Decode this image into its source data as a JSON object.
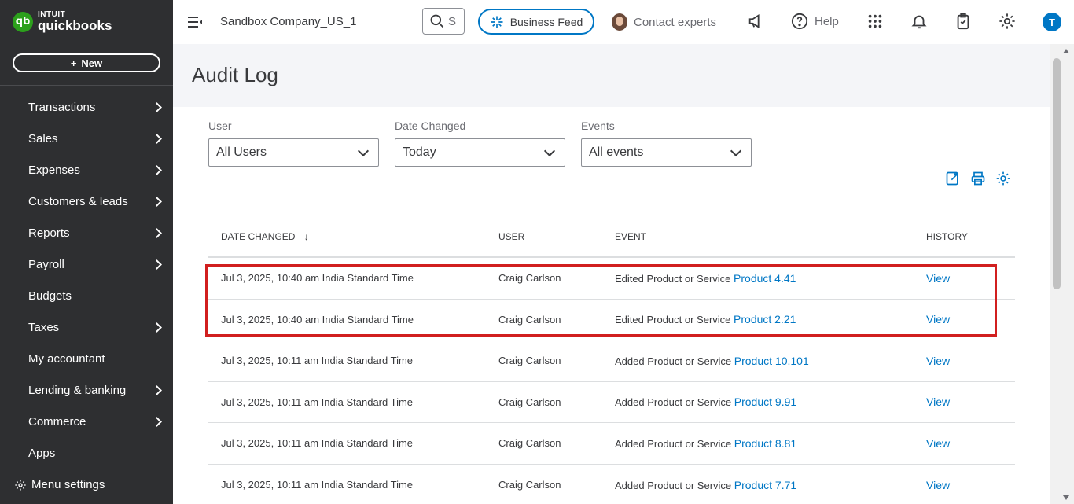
{
  "brand": {
    "intuit": "INTUIT",
    "product": "quickbooks",
    "logo_mark": "qb",
    "color": "#2ca01c"
  },
  "sidebar": {
    "new_label": "New",
    "items": [
      {
        "label": "Transactions",
        "has_chevron": true
      },
      {
        "label": "Sales",
        "has_chevron": true
      },
      {
        "label": "Expenses",
        "has_chevron": true
      },
      {
        "label": "Customers & leads",
        "has_chevron": true
      },
      {
        "label": "Reports",
        "has_chevron": true
      },
      {
        "label": "Payroll",
        "has_chevron": true
      },
      {
        "label": "Budgets",
        "has_chevron": false
      },
      {
        "label": "Taxes",
        "has_chevron": true
      },
      {
        "label": "My accountant",
        "has_chevron": false
      },
      {
        "label": "Lending & banking",
        "has_chevron": true
      },
      {
        "label": "Commerce",
        "has_chevron": true
      },
      {
        "label": "Apps",
        "has_chevron": false
      }
    ],
    "menu_settings_label": "Menu settings"
  },
  "topbar": {
    "company_name": "Sandbox Company_US_1",
    "search_placeholder": "S",
    "business_feed_label": "Business Feed",
    "contact_experts_label": "Contact experts",
    "help_label": "Help",
    "user_initial": "T",
    "accent": "#0077c5"
  },
  "page": {
    "title": "Audit Log",
    "filters": {
      "user": {
        "label": "User",
        "value": "All Users"
      },
      "date_changed": {
        "label": "Date Changed",
        "value": "Today"
      },
      "events": {
        "label": "Events",
        "value": "All events"
      }
    },
    "table": {
      "headers": {
        "date_changed": "DATE CHANGED",
        "sort_icon": "↓",
        "user": "USER",
        "event": "EVENT",
        "history": "HISTORY"
      },
      "rows": [
        {
          "date": "Jul 3, 2025, 10:40 am India Standard Time",
          "user": "Craig Carlson",
          "event": "Edited Product or Service",
          "item": "Product 4.41",
          "history": "View"
        },
        {
          "date": "Jul 3, 2025, 10:40 am India Standard Time",
          "user": "Craig Carlson",
          "event": "Edited Product or Service",
          "item": "Product 2.21",
          "history": "View"
        },
        {
          "date": "Jul 3, 2025, 10:11 am India Standard Time",
          "user": "Craig Carlson",
          "event": "Added Product or Service",
          "item": "Product 10.101",
          "history": "View"
        },
        {
          "date": "Jul 3, 2025, 10:11 am India Standard Time",
          "user": "Craig Carlson",
          "event": "Added Product or Service",
          "item": "Product 9.91",
          "history": "View"
        },
        {
          "date": "Jul 3, 2025, 10:11 am India Standard Time",
          "user": "Craig Carlson",
          "event": "Added Product or Service",
          "item": "Product 8.81",
          "history": "View"
        },
        {
          "date": "Jul 3, 2025, 10:11 am India Standard Time",
          "user": "Craig Carlson",
          "event": "Added Product or Service",
          "item": "Product 7.71",
          "history": "View"
        }
      ]
    },
    "highlight_color": "#d11f1f"
  }
}
